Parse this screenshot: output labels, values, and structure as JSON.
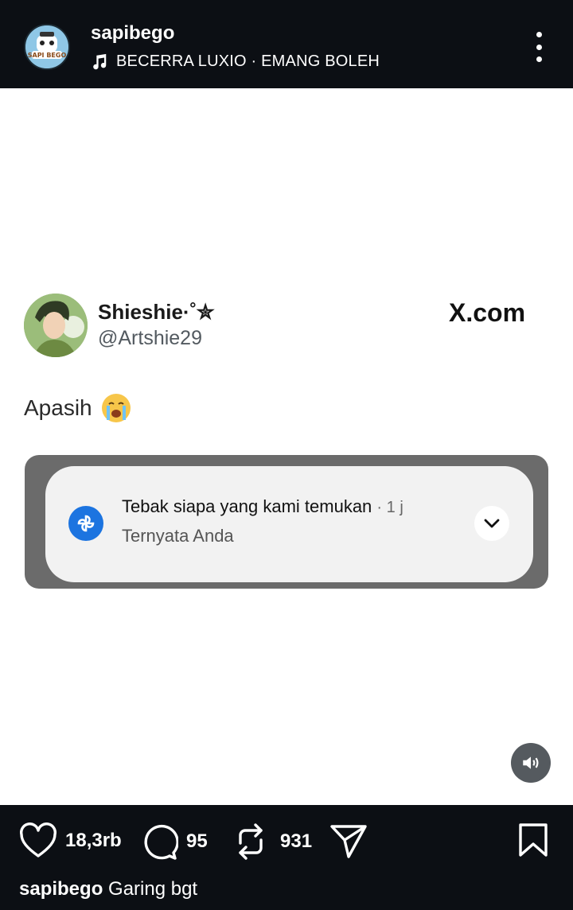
{
  "header": {
    "username": "sapibego",
    "avatar_text": "SAPI BEGO",
    "music_track": "BECERRA LUXIO · EMANG BOLEH"
  },
  "tweet": {
    "display_name": "Shieshie·˚✮",
    "handle": "@Artshie29",
    "source": "X.com",
    "text": "Apasih"
  },
  "notification": {
    "title": "Tebak siapa yang kami temukan",
    "time": "· 1 j",
    "subtitle": "Ternyata Anda"
  },
  "actions": {
    "likes": "18,3rb",
    "comments": "95",
    "reposts": "931"
  },
  "caption": {
    "username": "sapibego",
    "text": "Garing bgt"
  },
  "colors": {
    "bar_background": "#0c0f14",
    "notification_icon": "#1c74e0"
  }
}
